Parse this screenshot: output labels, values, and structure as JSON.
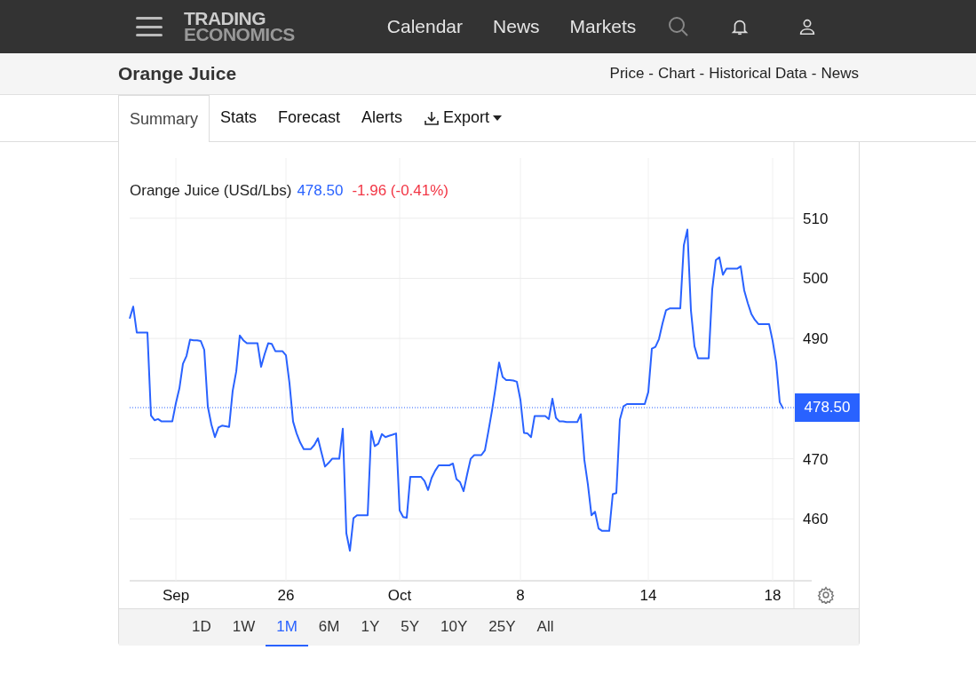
{
  "navbar": {
    "logo": [
      "TRADING",
      "ECONOMICS"
    ],
    "links": [
      "Calendar",
      "News",
      "Markets"
    ]
  },
  "header": {
    "title": "Orange Juice",
    "links": [
      "Price",
      "Chart",
      "Historical Data",
      "News"
    ],
    "separator": "-"
  },
  "tabs": [
    {
      "label": "Summary",
      "selected": true
    },
    {
      "label": "Stats",
      "selected": false
    },
    {
      "label": "Forecast",
      "selected": false
    },
    {
      "label": "Alerts",
      "selected": false
    },
    {
      "label": "Export",
      "selected": false,
      "kind": "dropdown"
    }
  ],
  "chart": {
    "legend": {
      "price": "478.50",
      "change": "-1.96 (-0.41%)"
    },
    "last_label": "478.50",
    "chart_data": {
      "type": "line",
      "categories": [
        null,
        null,
        null,
        null,
        null,
        null,
        null,
        null,
        null,
        null,
        null,
        null,
        null,
        "Sep",
        null,
        null,
        null,
        null,
        null,
        null,
        null,
        null,
        null,
        null,
        null,
        null,
        null,
        null,
        null,
        null,
        null,
        null,
        null,
        null,
        null,
        null,
        null,
        null,
        null,
        null,
        null,
        null,
        null,
        null,
        "26",
        null,
        null,
        null,
        null,
        null,
        null,
        null,
        null,
        null,
        null,
        null,
        null,
        null,
        null,
        null,
        null,
        null,
        null,
        null,
        null,
        null,
        null,
        null,
        null,
        null,
        null,
        null,
        null,
        null,
        null,
        null,
        "Oct",
        null,
        null,
        null,
        null,
        null,
        null,
        null,
        null,
        null,
        null,
        null,
        null,
        null,
        null,
        null,
        null,
        null,
        null,
        null,
        null,
        null,
        null,
        null,
        null,
        null,
        null,
        null,
        null,
        null,
        null,
        null,
        null,
        null,
        "8",
        null,
        null,
        null,
        null,
        null,
        null,
        null,
        null,
        null,
        null,
        null,
        null,
        null,
        null,
        null,
        null,
        null,
        null,
        null,
        null,
        null,
        null,
        null,
        null,
        null,
        null,
        null,
        null,
        null,
        null,
        null,
        null,
        null,
        null,
        null,
        "14",
        null,
        null,
        null,
        null,
        null,
        null,
        null,
        null,
        null,
        null,
        null,
        null,
        null,
        null,
        null,
        null,
        null,
        null,
        null,
        null,
        null,
        null,
        null,
        null,
        null,
        null,
        null,
        null,
        null,
        null,
        null,
        null,
        null,
        null,
        "18",
        null,
        null,
        null
      ],
      "series": [
        {
          "name": "Orange Juice (USd/Lbs)",
          "color": "#2962ff",
          "values": [
            493.3,
            495.3,
            491,
            491,
            491,
            491,
            477.2,
            476.4,
            476.6,
            476.2,
            476.2,
            476.2,
            476.2,
            479.2,
            481.7,
            485.8,
            487.1,
            489.8,
            489.7,
            489.7,
            489.6,
            488.1,
            478.7,
            475.7,
            473.6,
            475.2,
            475.5,
            475.4,
            475.3,
            481.3,
            484.5,
            490.5,
            489.7,
            489.2,
            489.2,
            489.2,
            489.2,
            485.3,
            487.4,
            489.2,
            489.1,
            487.9,
            487.9,
            487.9,
            487.2,
            482.5,
            476.2,
            474.2,
            472.7,
            471.6,
            471.6,
            471.6,
            472.3,
            473.4,
            471,
            468.7,
            469.3,
            470,
            470,
            470,
            475,
            457.6,
            454.7,
            460.1,
            460.6,
            460.6,
            460.6,
            460.6,
            474.6,
            472.1,
            472.5,
            474.1,
            473.6,
            473.8,
            474,
            474.2,
            461.4,
            460.3,
            460.2,
            467,
            467,
            467,
            467,
            466.3,
            464.8,
            466.8,
            468,
            468.9,
            468.9,
            468.9,
            468.9,
            469.2,
            466.6,
            466.1,
            464.6,
            467.4,
            470,
            470.6,
            470.6,
            470.6,
            471.4,
            474.6,
            478,
            481.8,
            486,
            483.6,
            483.1,
            483.1,
            483,
            482.8,
            479.8,
            474.3,
            474.2,
            473.6,
            477.1,
            477.1,
            477.1,
            477.1,
            476.6,
            480,
            476.8,
            476.2,
            476.2,
            476.1,
            476.1,
            476.1,
            476.1,
            477.4,
            469.8,
            465.7,
            460.6,
            461.2,
            458.4,
            458,
            458,
            458,
            464.1,
            464.3,
            476.5,
            478.7,
            479.1,
            479.1,
            479.1,
            479.1,
            479.1,
            479.1,
            481.1,
            488.3,
            488.6,
            489.9,
            492.5,
            494.7,
            495,
            495,
            495,
            495,
            505.5,
            508.1,
            494.7,
            488.7,
            486.7,
            486.7,
            486.7,
            486.7,
            498.2,
            503,
            503.5,
            500.6,
            501.6,
            501.6,
            501.6,
            501.6,
            502,
            498,
            495.9,
            494.1,
            493.1,
            492.4,
            492.4,
            492.4,
            492.4,
            489.6,
            486,
            479.4,
            478.3
          ]
        }
      ],
      "ylim": [
        450,
        520
      ],
      "grid": true,
      "ref_lines": [
        {
          "axis": "y",
          "value": 478.5,
          "color": "#2962ff"
        }
      ],
      "yticks": [
        460,
        470,
        490,
        500,
        510
      ]
    }
  },
  "ranges": [
    {
      "label": "1D",
      "selected": false
    },
    {
      "label": "1W",
      "selected": false
    },
    {
      "label": "1M",
      "selected": true
    },
    {
      "label": "6M",
      "selected": false
    },
    {
      "label": "1Y",
      "selected": false
    },
    {
      "label": "5Y",
      "selected": false
    },
    {
      "label": "10Y",
      "selected": false
    },
    {
      "label": "25Y",
      "selected": false
    },
    {
      "label": "All",
      "selected": false
    }
  ]
}
